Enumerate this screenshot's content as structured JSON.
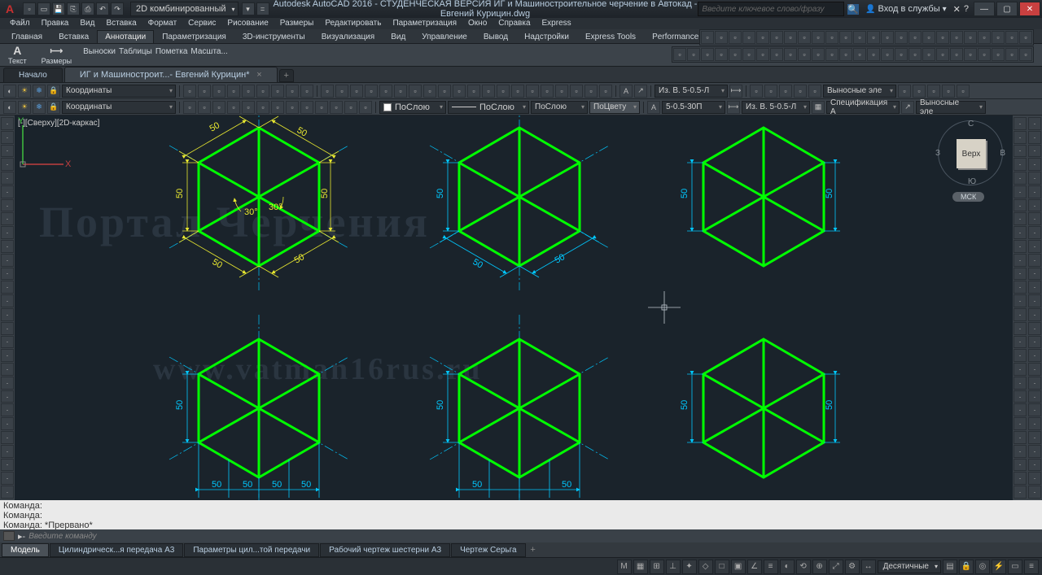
{
  "title": "Autodesk AutoCAD 2016 - СТУДЕНЧЕСКАЯ ВЕРСИЯ   ИГ и Машиностроительное черчение в Автокад - Евгений Курицин.dwg",
  "visual_style": "2D комбинированный",
  "search_placeholder": "Введите ключевое слово/фразу",
  "signin": "Вход в службы",
  "menubar": [
    "Файл",
    "Правка",
    "Вид",
    "Вставка",
    "Формат",
    "Сервис",
    "Рисование",
    "Размеры",
    "Редактировать",
    "Параметризация",
    "Окно",
    "Справка",
    "Express"
  ],
  "ribbon_tabs": [
    "Главная",
    "Вставка",
    "Аннотации",
    "Параметризация",
    "3D-инструменты",
    "Визуализация",
    "Вид",
    "Управление",
    "Вывод",
    "Надстройки",
    "Express Tools",
    "Performance"
  ],
  "ribbon_active": 2,
  "ribbon_big": [
    {
      "icon": "A",
      "label": "Текст",
      "color": "#d8d8d8"
    },
    {
      "icon": "⟷",
      "label": "Размеры",
      "color": "#d8d8d8"
    }
  ],
  "ribbon_panels": [
    "Выноски",
    "Таблицы",
    "Пометка",
    "Масшта..."
  ],
  "file_tabs": [
    {
      "label": "Начало",
      "active": false
    },
    {
      "label": "ИГ и Машиностроит...- Евгений Курицин*",
      "active": true
    }
  ],
  "toolrow1": {
    "layer_combo": "Координаты",
    "dim_style1": "Из. В. 5-0.5-Л",
    "leader_combo": "Выносные эле"
  },
  "toolrow2": {
    "color": "ПоСлою",
    "linetype": "ПоСлою",
    "lineweight": "ПоСлою",
    "plotstyle": "ПоЦвету",
    "textstyle": "5-0.5-30П",
    "dimstyle": "Из. В. 5-0.5-Л",
    "tablestyle": "Спецификация A",
    "leader": "Выносные эле"
  },
  "viewport_label": "[-][Сверху][2D-каркас]",
  "viewcube": {
    "face": "Верх",
    "n": "С",
    "s": "Ю",
    "e": "В",
    "w": "З",
    "cs": "МСК"
  },
  "watermark1": "Портал Черчения",
  "watermark2": "www.vatman16rus.ru",
  "cmd_history": [
    "Команда:",
    "Команда:",
    "Команда: *Прервано*"
  ],
  "cmd_placeholder": "Введите  команду",
  "bottom_tabs": [
    "Модель",
    "Цилиндрическ...я передача А3",
    "Параметры цил...той передачи",
    "Рабочий чертеж шестерни А3",
    "Чертеж Серьга"
  ],
  "bottom_active": 0,
  "status_units": "Десятичные",
  "ucs": {
    "x": "X",
    "y": "Y"
  },
  "hex_dim": "50",
  "hex_angle": "30°"
}
